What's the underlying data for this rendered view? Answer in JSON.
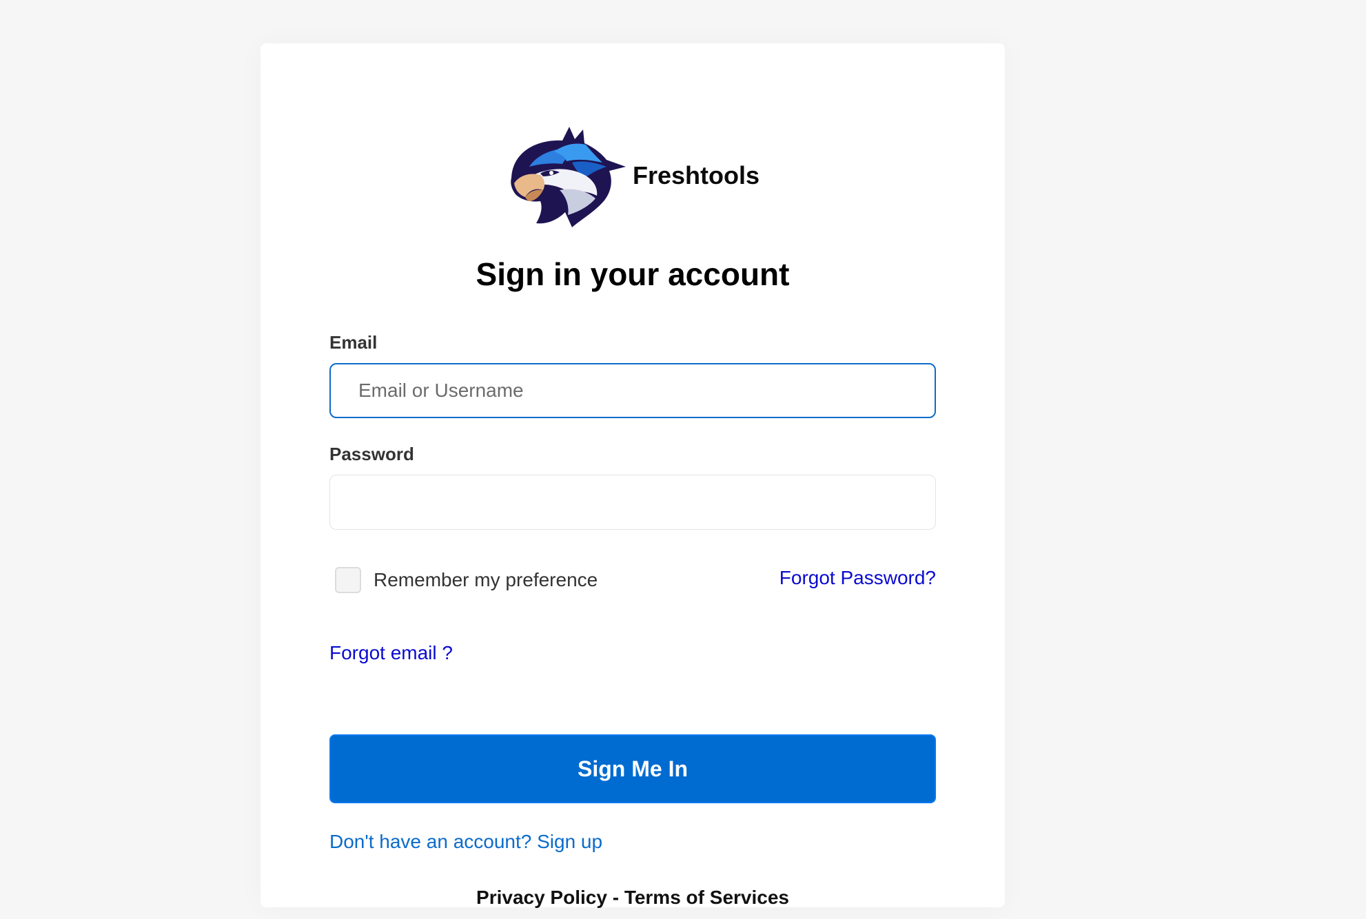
{
  "brand": {
    "name": "Freshtools",
    "logo_icon": "eagle-head-logo"
  },
  "title": "Sign in your account",
  "form": {
    "email_label": "Email",
    "email_placeholder": "Email or Username",
    "email_value": "",
    "password_label": "Password",
    "password_value": "",
    "remember_label": "Remember my preference",
    "remember_checked": false,
    "forgot_password": "Forgot Password?",
    "forgot_email": "Forgot email ?",
    "submit_label": "Sign Me In",
    "signup_text": "Don't have an account? Sign up"
  },
  "footer": {
    "privacy": "Privacy Policy",
    "separator": " - ",
    "terms": "Terms of Services"
  },
  "colors": {
    "primary": "#006bd0",
    "link": "#0a0ad0",
    "signup_link": "#0b6bcb",
    "background": "#f6f6f6",
    "card": "#ffffff"
  }
}
